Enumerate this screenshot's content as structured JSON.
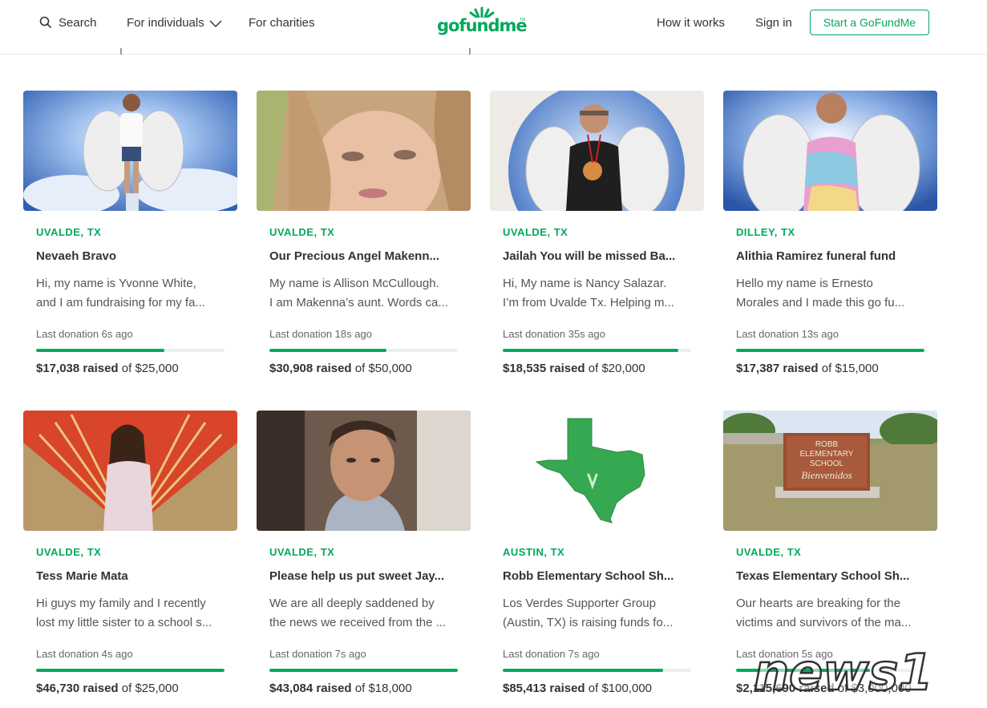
{
  "header": {
    "search_label": "Search",
    "individuals_label": "For individuals",
    "charities_label": "For charities",
    "logo_text": "gofundme",
    "how_it_works_label": "How it works",
    "sign_in_label": "Sign in",
    "start_label": "Start a GoFundMe"
  },
  "colors": {
    "brand_green": "#02a95c",
    "progress_track": "#e8f2ee"
  },
  "cards": [
    {
      "location": "UVALDE, TX",
      "title": "Nevaeh Bravo",
      "desc1": "Hi, my name is Yvonne White,",
      "desc2": "and I am fundraising for my fa...",
      "last": "Last donation 6s ago",
      "raised": "$17,038 raised",
      "goal": "of $25,000",
      "progress": 0.68
    },
    {
      "location": "UVALDE, TX",
      "title": "Our Precious Angel Makenn...",
      "desc1": "My name is Allison McCullough.",
      "desc2": "I am Makenna’s aunt. Words ca...",
      "last": "Last donation 18s ago",
      "raised": "$30,908 raised",
      "goal": "of $50,000",
      "progress": 0.62
    },
    {
      "location": "UVALDE, TX",
      "title": "Jailah You will be missed Ba...",
      "desc1": "Hi, My name is Nancy Salazar.",
      "desc2": "I’m from Uvalde Tx. Helping m...",
      "last": "Last donation 35s ago",
      "raised": "$18,535 raised",
      "goal": "of $20,000",
      "progress": 0.93
    },
    {
      "location": "DILLEY, TX",
      "title": "Alithia Ramirez funeral fund",
      "desc1": "Hello my name is Ernesto",
      "desc2": "Morales and I made this go fu...",
      "last": "Last donation 13s ago",
      "raised": "$17,387 raised",
      "goal": "of $15,000",
      "progress": 1.0
    },
    {
      "location": "UVALDE, TX",
      "title": "Tess Marie Mata",
      "desc1": "Hi guys my family and I recently",
      "desc2": "lost my little sister to a school s...",
      "last": "Last donation 4s ago",
      "raised": "$46,730 raised",
      "goal": "of $25,000",
      "progress": 1.0
    },
    {
      "location": "UVALDE, TX",
      "title": "Please help us put sweet Jay...",
      "desc1": "We are all deeply saddened by",
      "desc2": "the news we received from the ...",
      "last": "Last donation 7s ago",
      "raised": "$43,084 raised",
      "goal": "of $18,000",
      "progress": 1.0
    },
    {
      "location": "AUSTIN, TX",
      "title": "Robb Elementary School Sh...",
      "desc1": "Los Verdes Supporter Group",
      "desc2": "(Austin, TX) is raising funds fo...",
      "last": "Last donation 7s ago",
      "raised": "$85,413 raised",
      "goal": "of $100,000",
      "progress": 0.85
    },
    {
      "location": "UVALDE, TX",
      "title": "Texas Elementary School Sh...",
      "desc1": "Our hearts are breaking for the",
      "desc2": "victims and survivors of the ma...",
      "last": "Last donation 5s ago",
      "raised": "$2,115,690 raised",
      "goal": "of $3,000,000",
      "progress": 0.71
    }
  ],
  "school_sign": {
    "line1": "ROBB",
    "line2": "ELEMENTARY",
    "line3": "SCHOOL",
    "line4": "Bienvenidos"
  },
  "watermark": {
    "text": "news1"
  }
}
